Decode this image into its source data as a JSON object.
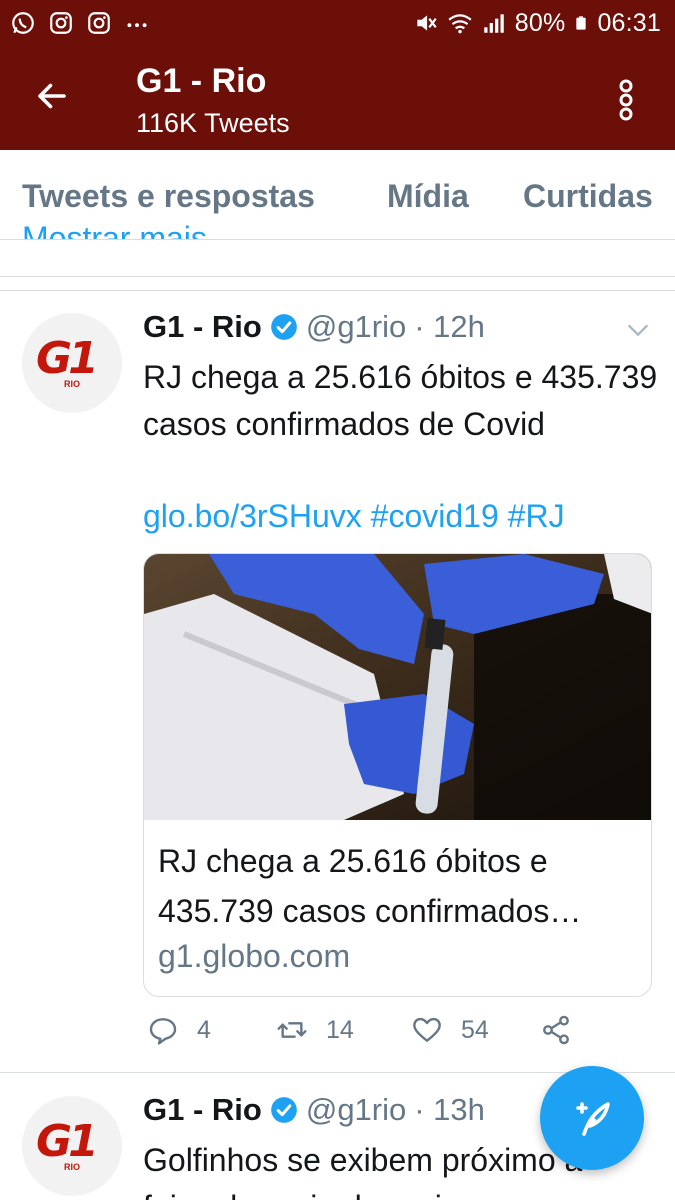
{
  "status_bar": {
    "battery_percent": "80%",
    "time": "06:31",
    "icons_left": [
      "whatsapp-icon",
      "instagram-icon",
      "instagram-icon",
      "more-dots-icon"
    ],
    "icons_right": [
      "mute-icon",
      "wifi-icon",
      "signal-icon",
      "battery-icon"
    ]
  },
  "header": {
    "title": "G1 - Rio",
    "subtitle": "116K Tweets",
    "accent_color": "#6d0f09"
  },
  "tabs": [
    {
      "label": "Tweets e respostas"
    },
    {
      "label": "Mídia"
    },
    {
      "label": "Curtidas"
    }
  ],
  "show_more_peek": "Mostrar mais",
  "tweets": [
    {
      "name": "G1 - Rio",
      "handle": "@g1rio",
      "time": "· 12h",
      "text": "RJ chega a 25.616 óbitos e 435.739 casos confirmados de Covid",
      "links": "glo.bo/3rSHuvx #covid19 #RJ",
      "card": {
        "title": "RJ chega a 25.616 óbitos e 435.739 casos confirmados…",
        "domain": "g1.globo.com"
      },
      "replies": "4",
      "retweets": "14",
      "likes": "54"
    },
    {
      "name": "G1 - Rio",
      "handle": "@g1rio",
      "time": "· 13h",
      "text": "Golfinhos se exibem próximo à faixa de areia da praia em"
    }
  ],
  "avatar_logo": {
    "main": "G1",
    "sub": "RIO"
  },
  "colors": {
    "link": "#1da1f2",
    "muted": "#657786",
    "brand_red": "#c4170c"
  }
}
